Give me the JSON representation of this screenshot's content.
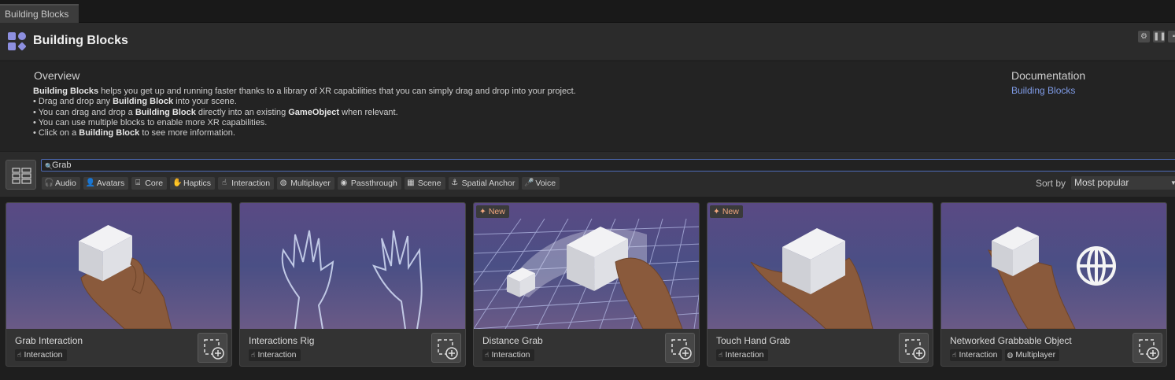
{
  "window": {
    "tab_label": "Building Blocks",
    "title": "Building Blocks"
  },
  "header": {
    "buttons": [
      "gear-icon",
      "layout-icon",
      "more-icon"
    ]
  },
  "overview": {
    "heading": "Overview",
    "intro_bold": "Building Blocks",
    "intro_rest": " helps you get up and running faster thanks to a library of XR capabilities that you can simply drag and drop into your project.",
    "line1_pre": "• Drag and drop any ",
    "line1_bold": "Building Block",
    "line1_post": " into your scene.",
    "line2_pre": "• You can drag and drop a ",
    "line2_bold": "Building Block",
    "line2_mid": " directly into an existing ",
    "line2_bold2": "GameObject",
    "line2_post": " when relevant.",
    "line3": "• You can use multiple blocks to enable more XR capabilities.",
    "line4_pre": "• Click on a ",
    "line4_bold": "Building Block",
    "line4_post": " to see more information.",
    "doc_heading": "Documentation",
    "doc_link": "Building Blocks"
  },
  "search": {
    "value": "Grab"
  },
  "filters": [
    {
      "label": "Audio",
      "icon": "headphones-icon",
      "glyph": "🎧"
    },
    {
      "label": "Avatars",
      "icon": "person-icon",
      "glyph": "👤"
    },
    {
      "label": "Core",
      "icon": "vr-headset-icon",
      "glyph": "⌸"
    },
    {
      "label": "Haptics",
      "icon": "hand-icon",
      "glyph": "✋"
    },
    {
      "label": "Interaction",
      "icon": "pointer-hand-icon",
      "glyph": "☝"
    },
    {
      "label": "Multiplayer",
      "icon": "globe-icon",
      "glyph": "◍"
    },
    {
      "label": "Passthrough",
      "icon": "eye-icon",
      "glyph": "◉"
    },
    {
      "label": "Scene",
      "icon": "grid-icon",
      "glyph": "▦"
    },
    {
      "label": "Spatial Anchor",
      "icon": "anchor-icon",
      "glyph": "⚓"
    },
    {
      "label": "Voice",
      "icon": "microphone-icon",
      "glyph": "🎤"
    }
  ],
  "sort": {
    "label": "Sort by",
    "value": "Most popular"
  },
  "new_label": "New",
  "cards": [
    {
      "title": "Grab Interaction",
      "new": false,
      "tags": [
        "Interaction"
      ]
    },
    {
      "title": "Interactions Rig",
      "new": false,
      "tags": [
        "Interaction"
      ]
    },
    {
      "title": "Distance Grab",
      "new": true,
      "tags": [
        "Interaction"
      ]
    },
    {
      "title": "Touch Hand Grab",
      "new": true,
      "tags": [
        "Interaction"
      ]
    },
    {
      "title": "Networked Grabbable Object",
      "new": false,
      "tags": [
        "Interaction",
        "Multiplayer"
      ]
    }
  ],
  "colors": {
    "accent": "#8d8fe0",
    "link": "#7f9be6",
    "new": "#f3a87f",
    "search_border": "#4e6cb8"
  }
}
